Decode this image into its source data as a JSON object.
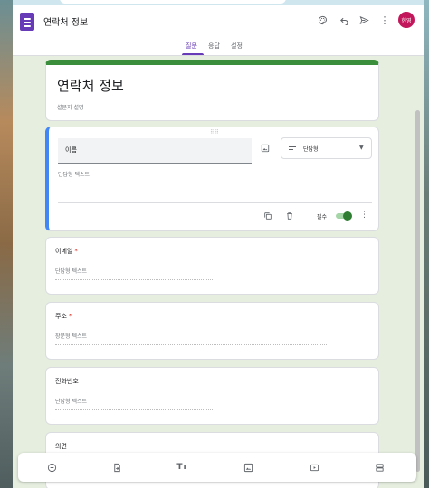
{
  "app": {
    "doc_title": "연락처 정보",
    "avatar_text": "현영",
    "accent_color": "#673ab7",
    "theme_color": "#3b8f3c"
  },
  "header_icons": [
    "palette-icon",
    "undo-icon",
    "send-icon",
    "more-vert-icon"
  ],
  "tabs": [
    {
      "label": "질문",
      "active": true
    },
    {
      "label": "응답",
      "active": false
    },
    {
      "label": "설정",
      "active": false
    }
  ],
  "form": {
    "title": "연락처 정보",
    "description_placeholder": "설문지 설명"
  },
  "active_question": {
    "title": "이름",
    "type_label": "단답형",
    "answer_hint": "단답형 텍스트",
    "required_label": "필수",
    "required_on": true
  },
  "questions": [
    {
      "title": "이메일",
      "required": "*",
      "hint": "단답형 텍스트"
    },
    {
      "title": "주소",
      "required": "*",
      "hint": "장문형 텍스트"
    },
    {
      "title": "전화번호",
      "required": "",
      "hint": "단답형 텍스트"
    },
    {
      "title": "의견",
      "required": "",
      "hint": ""
    }
  ],
  "bottom_toolbar": [
    "add-question-icon",
    "import-questions-icon",
    "add-title-icon",
    "add-image-icon",
    "add-video-icon",
    "add-section-icon"
  ]
}
